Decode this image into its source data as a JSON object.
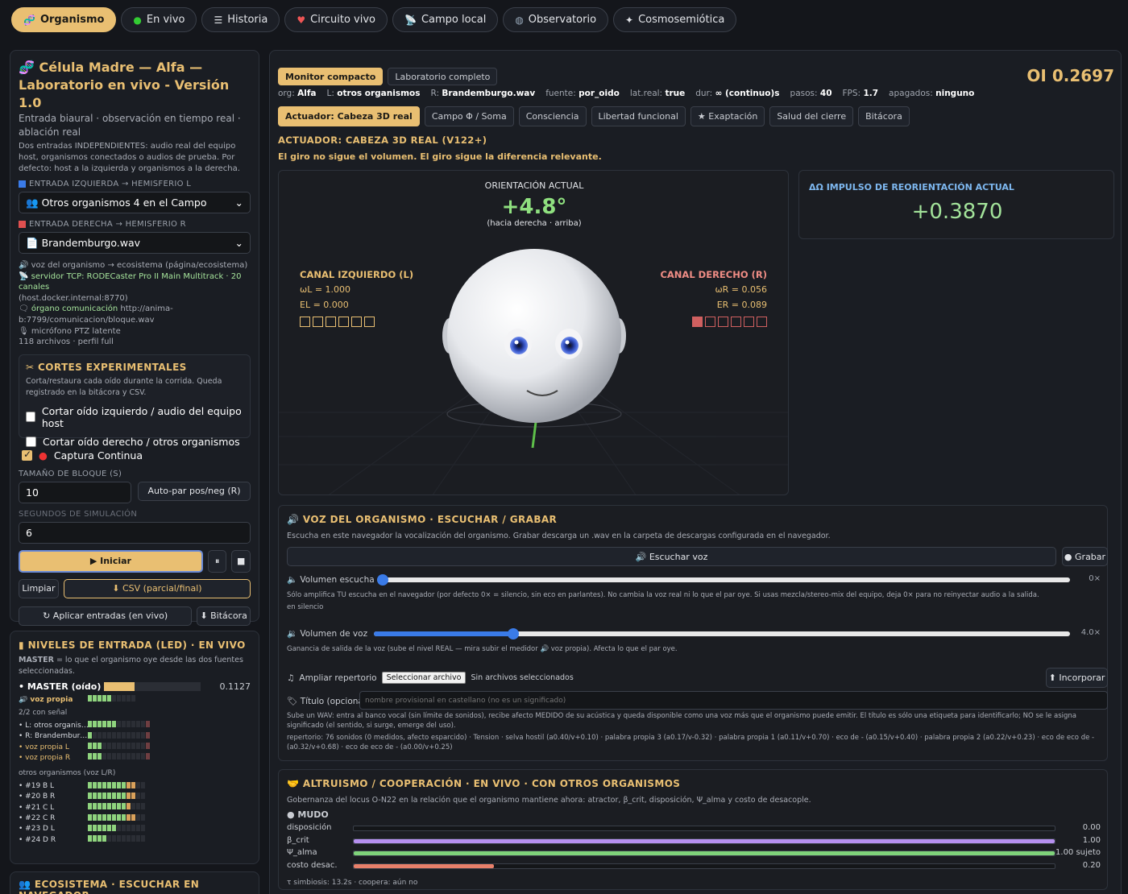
{
  "nav": {
    "tabs": [
      {
        "icon": "🧬",
        "label": "Organismo"
      },
      {
        "icon": "🟢",
        "label": "En vivo"
      },
      {
        "icon": "𝄜",
        "label": "Historia"
      },
      {
        "icon": "🫀",
        "label": "Circuito vivo"
      },
      {
        "icon": "📡",
        "label": "Campo local"
      },
      {
        "icon": "🌐",
        "label": "Observatorio"
      },
      {
        "icon": "✦",
        "label": "Cosmosemiótica"
      }
    ]
  },
  "left": {
    "title": "Célula Madre — Alfa — Laboratorio en vivo - Versión 1.0",
    "title_icon": "🧬",
    "subtitle": "Entrada biaural · observación en tiempo real · ablación real",
    "desc": "Dos entradas INDEPENDIENTES: audio real del equipo host, organismos conectados o audios de prueba. Por defecto: host a la izquierda y organismos a la derecha.",
    "left_input_label": "ENTRADA IZQUIERDA → HEMISFERIO L",
    "left_input_value": "Otros organismos 4 en el Campo",
    "right_input_label": "ENTRADA DERECHA → HEMISFERIO R",
    "right_input_value": "Brandemburgo.wav",
    "info1": "voz del organismo → ecosistema (página/ecosistema)",
    "info2": "servidor TCP: RODECaster Pro II Main Multitrack · 20 canales",
    "info2b": "(host.docker.internal:8770)",
    "info3a": "órgano comunicación",
    "info3b": " http://anima-b:7799/comunicacion/bloque.wav",
    "info4": "micrófono PTZ latente",
    "info5": "118 archivos · perfil full",
    "cuts_title": "CORTES EXPERIMENTALES",
    "cuts_desc": "Corta/restaura cada oído durante la corrida. Queda registrado en la bitácora y CSV.",
    "cut_left": "Cortar oído izquierdo / audio del equipo host",
    "cut_right": "Cortar oído derecho / otros organismos",
    "capture": "Captura Continua",
    "block_label": "TAMAÑO DE BLOQUE (S)",
    "block_value": "10",
    "autopair": "Auto-par pos/neg (R)",
    "sim_label": "SEGUNDOS DE SIMULACIÓN",
    "sim_value": "6",
    "start": "▶ Iniciar",
    "pause": "⏸",
    "stop": "■",
    "clear": "Limpiar",
    "csv": "⬇ CSV (parcial/final)",
    "apply": "↻ Aplicar entradas (en vivo)",
    "log": "⬇ Bitácora"
  },
  "levels": {
    "title": "NIVELES DE ENTRADA (LED) · EN VIVO",
    "desc_b": "MASTER",
    "desc": " = lo que el organismo oye desde las dos fuentes seleccionadas.",
    "master_label": "MASTER (oído)",
    "master_value": "0.1127",
    "master_fraction": 0.32,
    "voz_propia": "voz propia",
    "signal": "2/2 con señal",
    "rows": [
      {
        "name": "L: otros organis…",
        "on": 6,
        "color": "g"
      },
      {
        "name": "R: Brandembur…",
        "on": 1,
        "color": "g"
      },
      {
        "name": "voz propia L",
        "on": 3,
        "color": "g"
      },
      {
        "name": "voz propia R",
        "on": 3,
        "color": "g"
      }
    ],
    "others_label": "otros organismos (voz L/R)",
    "others": [
      {
        "name": "#19 B L",
        "on": 10
      },
      {
        "name": "#20 B R",
        "on": 10
      },
      {
        "name": "#21 C L",
        "on": 9
      },
      {
        "name": "#22 C R",
        "on": 10
      },
      {
        "name": "#23 D L",
        "on": 6
      },
      {
        "name": "#24 D R",
        "on": 4
      }
    ]
  },
  "eco": {
    "title": "ECOSISTEMA · ESCUCHAR EN NAVEGADOR"
  },
  "main": {
    "mode_tabs": [
      "Monitor compacto",
      "Laboratorio completo"
    ],
    "oi": "OI 0.2697",
    "meta": [
      {
        "k": "org:",
        "v": "Alfa"
      },
      {
        "k": "L:",
        "v": "otros organismos"
      },
      {
        "k": "R:",
        "v": "Brandemburgo.wav"
      },
      {
        "k": "fuente:",
        "v": "por_oido"
      },
      {
        "k": "lat.real:",
        "v": "true"
      },
      {
        "k": "dur:",
        "v": "∞ (continuo)s"
      },
      {
        "k": "pasos:",
        "v": "40"
      },
      {
        "k": "FPS:",
        "v": "1.7"
      },
      {
        "k": "apagados:",
        "v": "ninguno"
      }
    ],
    "subtabs": [
      "Actuador: Cabeza 3D real",
      "Campo Φ / Soma",
      "Consciencia",
      "Libertad funcional",
      "★ Exaptación",
      "Salud del cierre",
      "Bitácora"
    ],
    "actuator_title": "ACTUADOR: CABEZA 3D REAL (V122+)",
    "actuator_sub": "El giro no sigue el volumen. El giro sigue la diferencia relevante.",
    "orient_label": "ORIENTACIÓN ACTUAL",
    "orient_value": "+4.8°",
    "orient_dir": "(hacia derecha · arriba)",
    "ch_left_title": "CANAL IZQUIERDO (L)",
    "wL": "ωL = 1.000",
    "EL": "EL = 0.000",
    "ch_right_title": "CANAL DERECHO (R)",
    "wR": "ωR = 0.056",
    "ER": "ER = 0.089",
    "impulse_title": "ΔΩ IMPULSO DE REORIENTACIÓN ACTUAL",
    "impulse_value": "+0.3870"
  },
  "voice": {
    "title": "VOZ DEL ORGANISMO · ESCUCHAR / GRABAR",
    "desc": "Escucha en este navegador la vocalización del organismo. Grabar descarga un .wav en la carpeta de descargas configurada en el navegador.",
    "listen": "Escuchar voz",
    "record": "● Grabar",
    "vol_label": "Volumen escucha",
    "vol_value": "0×",
    "vol_fraction": 0.0,
    "vol_desc": "Sólo amplifica TU escucha en el navegador (por defecto 0× = silencio, sin eco en parlantes). No cambia la voz real ni lo que el par oye. Si usas mezcla/stereo-mix del equipo, deja 0× para no reinyectar audio a la salida.",
    "vol_state": "en silencio",
    "gain_label": "Volumen de voz",
    "gain_value": "4.0×",
    "gain_fraction": 0.2,
    "gain_desc_a": "Ganancia de salida de la voz (sube el nivel REAL — mira subir el medidor",
    "gain_desc_b": "voz propia). Afecta lo que el par oye.",
    "rep_label": "Ampliar repertorio",
    "file_btn": "Seleccionar archivo",
    "file_none": "Sin archivos seleccionados",
    "incorporate": "⬆ Incorporar",
    "title_label": "Título (opcional)",
    "title_placeholder": "nombre provisional en castellano (no es un significado)",
    "upload_desc": "Sube un WAV: entra al banco vocal (sin límite de sonidos), recibe afecto MEDIDO de su acústica y queda disponible como una voz más que el organismo puede emitir. El título es sólo una etiqueta para identificarlo; NO se le asigna significado (el sentido, si surge, emerge del uso).",
    "repertoire": "repertorio: 76 sonidos (0 medidos, afecto esparcido) · Tension · selva hostil (a0.40/v+0.10) · palabra propia 3 (a0.17/v-0.32) · palabra propia 1 (a0.11/v+0.70) · eco de - (a0.15/v+0.40) · palabra propia 2 (a0.22/v+0.23) · eco de eco de - (a0.32/v+0.68) · eco de eco de - (a0.00/v+0.25)"
  },
  "altruism": {
    "title": "ALTRUISMO / COOPERACIÓN · EN VIVO · CON OTROS ORGANISMOS",
    "desc": "Gobernanza del locus O-N22 en la relación que el organismo mantiene ahora: atractor, β_crit, disposición, Ψ_alma y costo de desacople.",
    "state": "● MUDO",
    "bars": [
      {
        "label": "disposición",
        "value": "0.00",
        "fraction": 0.0,
        "color": "#888"
      },
      {
        "label": "β_crit",
        "value": "1.00",
        "fraction": 1.0,
        "color": "#b690f0"
      },
      {
        "label": "Ψ_alma",
        "value": "1.00 sujeto",
        "fraction": 1.0,
        "color": "#7fd37a"
      },
      {
        "label": "costo desac.",
        "value": "0.20",
        "fraction": 0.2,
        "color": "#e8806a"
      }
    ],
    "footer": "τ simbiosis: 13.2s · coopera: aún no"
  }
}
